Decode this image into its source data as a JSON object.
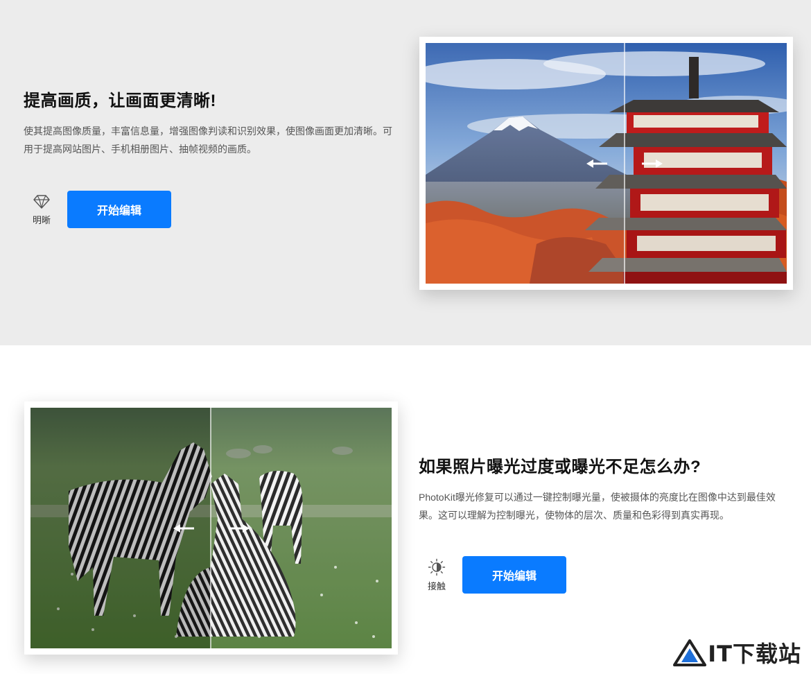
{
  "section1": {
    "heading": "提高画质，让画面更清晰!",
    "description": "使其提高图像质量，丰富信息量，增强图像判读和识别效果，使图像画面更加清晰。可用于提高网站图片、手机相册图片、抽帧视频的画质。",
    "feature_icon": "diamond-icon",
    "feature_label": "明晰",
    "button_label": "开始编辑"
  },
  "section2": {
    "heading": "如果照片曝光过度或曝光不足怎么办?",
    "description": "PhotoKit曝光修复可以通过一键控制曝光量，使被摄体的亮度比在图像中达到最佳效果。这可以理解为控制曝光，使物体的层次、质量和色彩得到真实再现。",
    "feature_icon": "brightness-icon",
    "feature_label": "接触",
    "button_label": "开始编辑"
  },
  "logo": {
    "text": "IT下载站"
  },
  "colors": {
    "accent": "#0a7bff",
    "section1_bg": "#ececec",
    "section2_bg": "#ffffff"
  }
}
